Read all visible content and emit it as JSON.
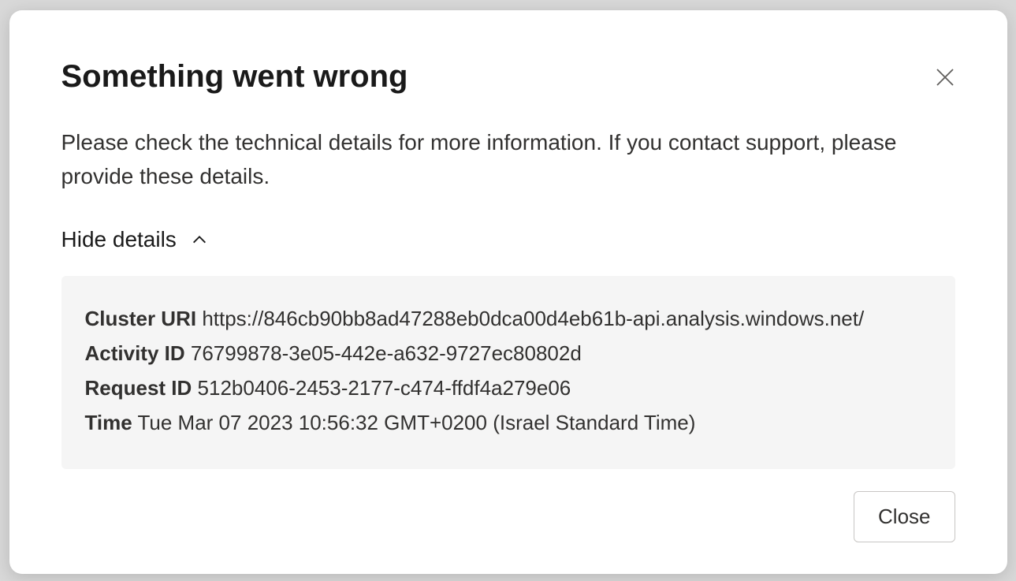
{
  "dialog": {
    "title": "Something went wrong",
    "message": "Please check the technical details for more information. If you contact support, please provide these details.",
    "toggle_label": "Hide details",
    "details": {
      "cluster_uri_label": "Cluster URI",
      "cluster_uri_value": "https://846cb90bb8ad47288eb0dca00d4eb61b-api.analysis.windows.net/",
      "activity_id_label": "Activity ID",
      "activity_id_value": "76799878-3e05-442e-a632-9727ec80802d",
      "request_id_label": "Request ID",
      "request_id_value": "512b0406-2453-2177-c474-ffdf4a279e06",
      "time_label": "Time",
      "time_value": "Tue Mar 07 2023 10:56:32 GMT+0200 (Israel Standard Time)"
    },
    "close_button_label": "Close"
  }
}
